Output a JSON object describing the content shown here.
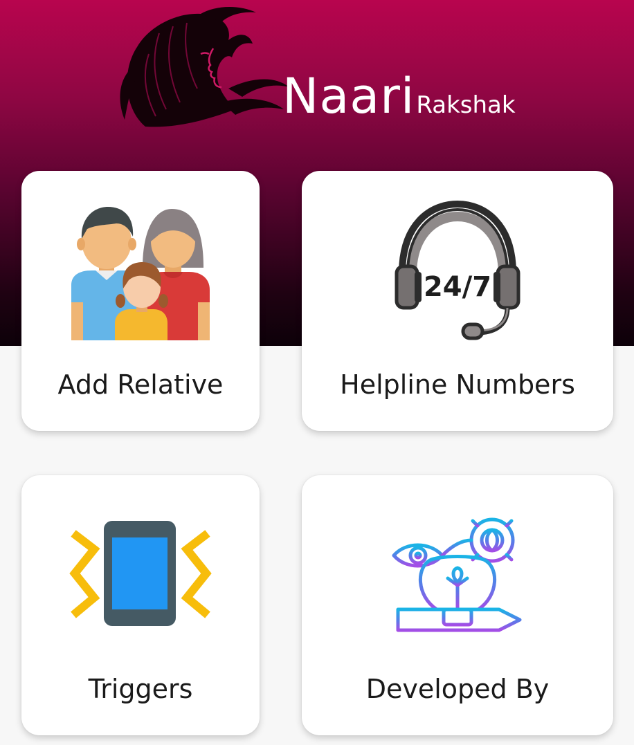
{
  "app": {
    "brand_main": "Naari",
    "brand_sub": "Rakshak"
  },
  "colors": {
    "header_top": "#b8054e",
    "header_bottom": "#0d0109",
    "card_background": "#ffffff",
    "page_background": "#f7f7f7",
    "label_text": "#1a1a1a"
  },
  "cards": [
    {
      "label": "Add Relative",
      "icon": "family-icon"
    },
    {
      "label": "Helpline Numbers",
      "icon": "headset-24-7-icon"
    },
    {
      "label": "Triggers",
      "icon": "vibrating-phone-icon"
    },
    {
      "label": "Developed By",
      "icon": "idea-gear-icon"
    }
  ],
  "helpline_icon_text": "24/7"
}
